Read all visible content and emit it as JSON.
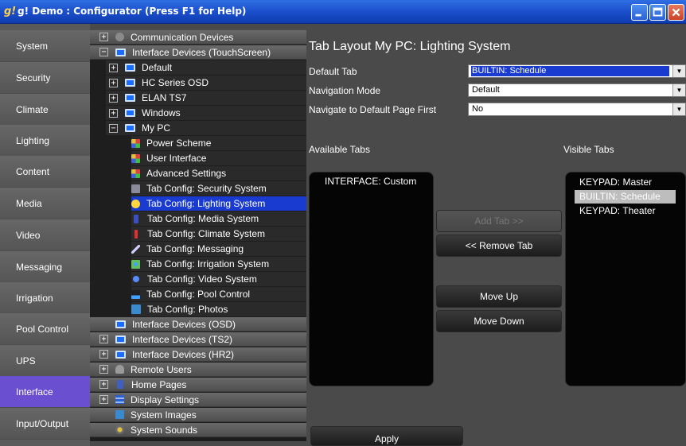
{
  "window": {
    "title": "g! Demo : Configurator   (Press F1 for Help)",
    "app_icon": "g!"
  },
  "nav": {
    "items": [
      "System",
      "Security",
      "Climate",
      "Lighting",
      "Content",
      "Media",
      "Video",
      "Messaging",
      "Irrigation",
      "Pool Control",
      "UPS",
      "Interface",
      "Input/Output"
    ],
    "active": "Interface"
  },
  "tree": {
    "communication_devices": "Communication Devices",
    "interface_touchscreen": "Interface Devices (TouchScreen)",
    "default": "Default",
    "hc_series_osd": "HC Series OSD",
    "elan_ts7": "ELAN TS7",
    "windows": "Windows",
    "my_pc": "My PC",
    "power_scheme": "Power Scheme",
    "user_interface": "User Interface",
    "advanced_settings": "Advanced Settings",
    "tab_security": "Tab Config: Security System",
    "tab_lighting": "Tab Config: Lighting System",
    "tab_media": "Tab Config: Media System",
    "tab_climate": "Tab Config: Climate System",
    "tab_messaging": "Tab Config: Messaging",
    "tab_irrigation": "Tab Config: Irrigation System",
    "tab_video": "Tab Config: Video System",
    "tab_pool": "Tab Config: Pool Control",
    "tab_photos": "Tab Config: Photos",
    "interface_osd": "Interface Devices (OSD)",
    "interface_ts2": "Interface Devices (TS2)",
    "interface_hr2": "Interface Devices (HR2)",
    "remote_users": "Remote Users",
    "home_pages": "Home Pages",
    "display_settings": "Display Settings",
    "system_images": "System Images",
    "system_sounds": "System Sounds",
    "expand_symbol": "+",
    "collapse_symbol": "−"
  },
  "panel": {
    "title": "Tab Layout My PC: Lighting System",
    "default_tab_label": "Default Tab",
    "default_tab_value": "BUILTIN: Schedule",
    "navigation_mode_label": "Navigation Mode",
    "navigation_mode_value": "Default",
    "navigate_default_label": "Navigate to Default Page First",
    "navigate_default_value": "No",
    "available_tabs_label": "Available Tabs",
    "visible_tabs_label": "Visible Tabs",
    "available_tabs": [
      "INTERFACE: Custom"
    ],
    "visible_tabs": [
      "KEYPAD: Master",
      "BUILTIN: Schedule",
      "KEYPAD: Theater"
    ],
    "add_tab": "Add Tab >>",
    "remove_tab": "<< Remove Tab",
    "move_up": "Move Up",
    "move_down": "Move Down",
    "apply": "Apply"
  },
  "colors": {
    "titlebar": "#1b4fcc",
    "selection": "#1a3bd0",
    "nav_active": "#6a4fd0"
  }
}
